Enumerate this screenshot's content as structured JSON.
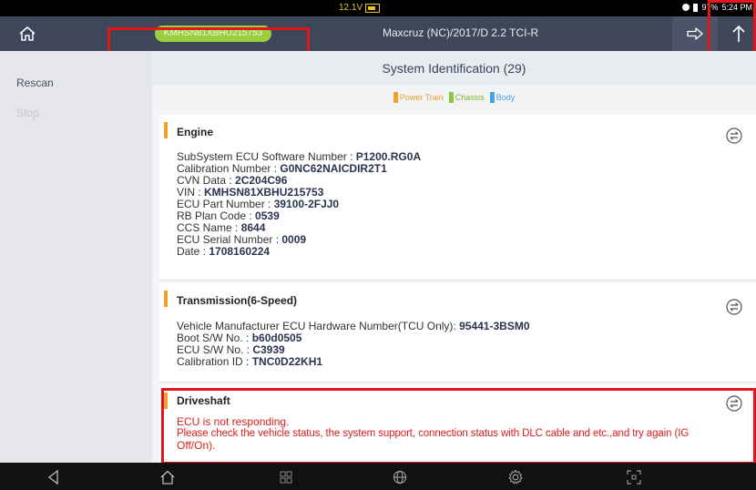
{
  "status": {
    "voltage": "12.1V",
    "battery_percent": "97%",
    "time": "5:24 PM"
  },
  "header": {
    "vin": "KMHSN81XBHU215753",
    "vehicle": "Maxcruz (NC)/2017/D 2.2 TCI-R"
  },
  "sidebar": {
    "rescan": "Rescan",
    "stop": "Stop"
  },
  "page": {
    "title": "System Identification (29)"
  },
  "legend": [
    {
      "label": "Power Train",
      "color": "#f0a02b"
    },
    {
      "label": "Chassis",
      "color": "#8dc63f"
    },
    {
      "label": "Body",
      "color": "#4aa3df"
    }
  ],
  "engine": {
    "title": "Engine",
    "rows": [
      {
        "label": "SubSystem ECU Software Number : ",
        "value": "P1200.RG0A"
      },
      {
        "label": "Calibration Number : ",
        "value": "G0NC62NAICDIR2T1"
      },
      {
        "label": "CVN Data : ",
        "value": "2C204C96"
      },
      {
        "label": "VIN : ",
        "value": "KMHSN81XBHU215753"
      },
      {
        "label": "ECU Part Number : ",
        "value": "39100-2FJJ0"
      },
      {
        "label": "RB Plan Code : ",
        "value": "0539"
      },
      {
        "label": "CCS Name : ",
        "value": "8644"
      },
      {
        "label": "ECU Serial Number : ",
        "value": "0009"
      },
      {
        "label": "Date : ",
        "value": "1708160224"
      }
    ]
  },
  "transmission": {
    "title": "Transmission(6-Speed)",
    "rows": [
      {
        "label": "Vehicle Manufacturer ECU Hardware Number(TCU Only): ",
        "value": "95441-3BSM0"
      },
      {
        "label": "Boot S/W No. : ",
        "value": "b60d0505"
      },
      {
        "label": "ECU S/W No. : ",
        "value": "C3939"
      },
      {
        "label": "Calibration ID : ",
        "value": "TNC0D22KH1"
      }
    ]
  },
  "driveshaft": {
    "title": "Driveshaft",
    "error_line1": "ECU is not responding.",
    "error_line2": "Please check the vehicle status, the system support, connection status with DLC cable and etc.,and try again (IG",
    "error_line3": "Off/On)."
  }
}
